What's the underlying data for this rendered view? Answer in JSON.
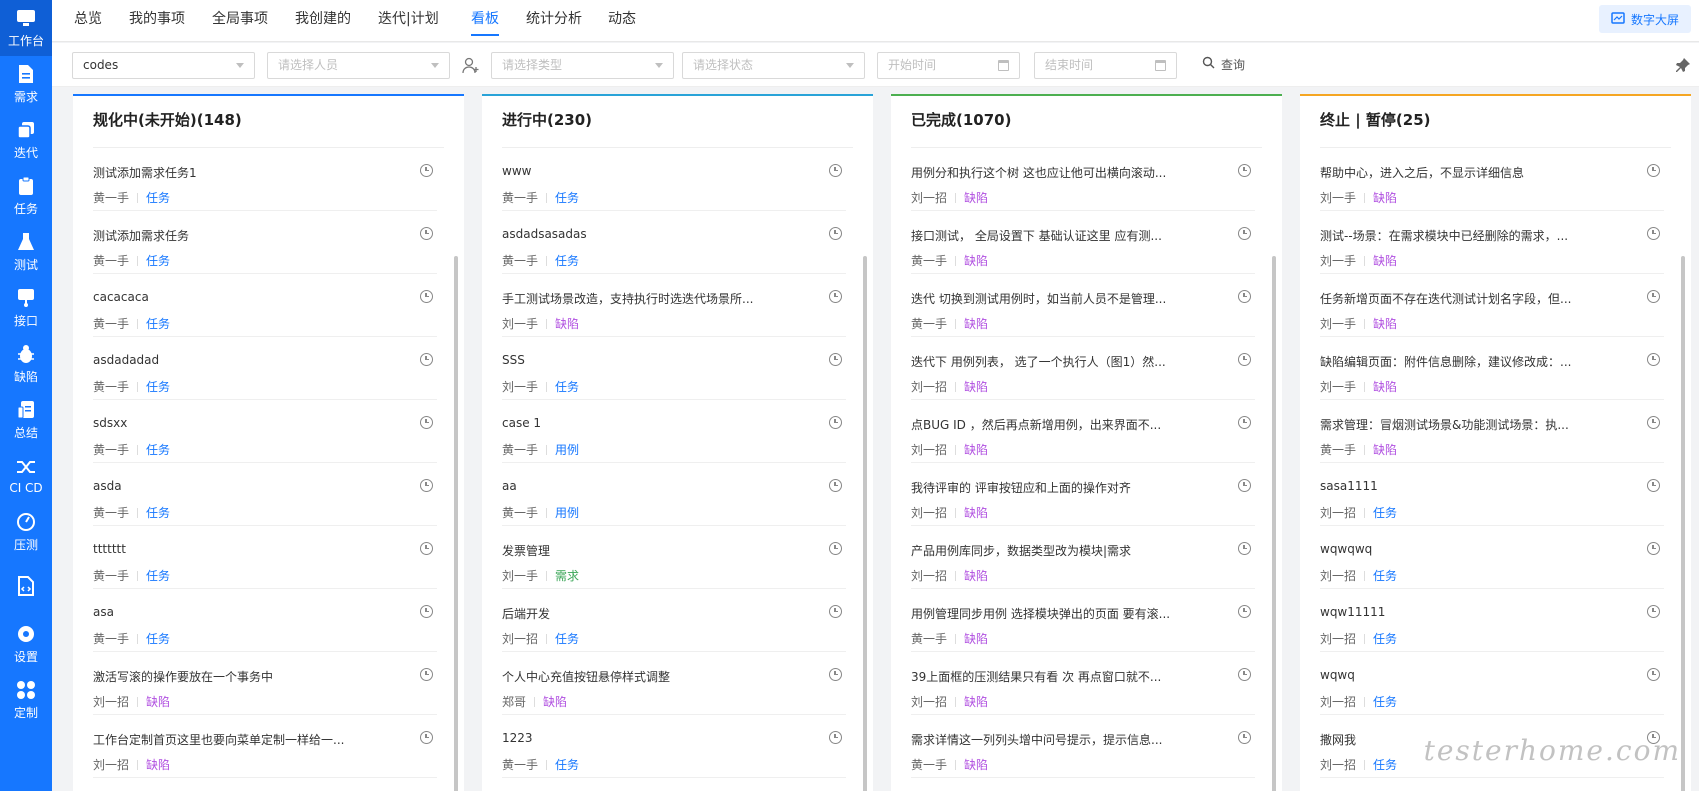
{
  "sidebar": {
    "items": [
      {
        "label": "工作台",
        "icon": "monitor-icon"
      },
      {
        "label": "需求",
        "icon": "document-icon"
      },
      {
        "label": "迭代",
        "icon": "layers-icon"
      },
      {
        "label": "任务",
        "icon": "clipboard-icon"
      },
      {
        "label": "测试",
        "icon": "flask-icon"
      },
      {
        "label": "接口",
        "icon": "api-icon"
      },
      {
        "label": "缺陷",
        "icon": "bug-icon"
      },
      {
        "label": "总结",
        "icon": "report-icon"
      },
      {
        "label": "CI CD",
        "icon": "shuffle-icon"
      },
      {
        "label": "压测",
        "icon": "gauge-icon"
      },
      {
        "label": "",
        "icon": "file-code-icon"
      },
      {
        "label": "设置",
        "icon": "gear-icon"
      },
      {
        "label": "定制",
        "icon": "grid-icon"
      }
    ]
  },
  "topnav": {
    "tabs": [
      "总览",
      "我的事项",
      "全局事项",
      "我创建的",
      "迭代|计划",
      "看板",
      "统计分析",
      "动态"
    ],
    "active": "看板",
    "screen_button": "数字大屏"
  },
  "filters": {
    "project": "codes",
    "person_placeholder": "请选择人员",
    "type_placeholder": "请选择类型",
    "status_placeholder": "请选择状态",
    "start_placeholder": "开始时间",
    "end_placeholder": "结束时间",
    "query_label": "查询"
  },
  "colors": {
    "planning": "#1677ff",
    "in_progress": "#29a3d8",
    "done": "#4caf50",
    "stopped": "#f5a623"
  },
  "columns": [
    {
      "title": "规化中(未开始)(148)",
      "cards": [
        {
          "title": "测试添加需求任务1",
          "person": "黄一手",
          "type": "任务"
        },
        {
          "title": "测试添加需求任务",
          "person": "黄一手",
          "type": "任务"
        },
        {
          "title": "cacacaca",
          "person": "黄一手",
          "type": "任务"
        },
        {
          "title": "asdadadad",
          "person": "黄一手",
          "type": "任务"
        },
        {
          "title": "sdsxx",
          "person": "黄一手",
          "type": "任务"
        },
        {
          "title": "asda",
          "person": "黄一手",
          "type": "任务"
        },
        {
          "title": "ttttttt",
          "person": "黄一手",
          "type": "任务"
        },
        {
          "title": "asa",
          "person": "黄一手",
          "type": "任务"
        },
        {
          "title": "激活写滚的操作要放在一个事务中",
          "person": "刘一招",
          "type": "缺陷"
        },
        {
          "title": "工作台定制首页这里也要向菜单定制一样给一...",
          "person": "刘一招",
          "type": "缺陷"
        }
      ]
    },
    {
      "title": "进行中(230)",
      "cards": [
        {
          "title": "www",
          "person": "黄一手",
          "type": "任务"
        },
        {
          "title": "asdadsasadas",
          "person": "黄一手",
          "type": "任务"
        },
        {
          "title": "手工测试场景改造，支持执行时选迭代场景所...",
          "person": "刘一手",
          "type": "缺陷"
        },
        {
          "title": "SSS",
          "person": "刘一手",
          "type": "任务"
        },
        {
          "title": "case 1",
          "person": "黄一手",
          "type": "用例"
        },
        {
          "title": "aa",
          "person": "黄一手",
          "type": "用例"
        },
        {
          "title": "发票管理",
          "person": "刘一手",
          "type": "需求"
        },
        {
          "title": "后端开发",
          "person": "刘一招",
          "type": "任务"
        },
        {
          "title": "个人中心充值按钮悬停样式调整",
          "person": "郑哥",
          "type": "缺陷"
        },
        {
          "title": "1223",
          "person": "黄一手",
          "type": "任务"
        }
      ]
    },
    {
      "title": "已完成(1070)",
      "cards": [
        {
          "title": "用例分和执行这个树 这也应让他可出横向滚动...",
          "person": "刘一招",
          "type": "缺陷"
        },
        {
          "title": "接口测试， 全局设置下 基础认证这里 应有测...",
          "person": "黄一手",
          "type": "缺陷"
        },
        {
          "title": "迭代 切换到测试用例时，如当前人员不是管理...",
          "person": "黄一手",
          "type": "缺陷"
        },
        {
          "title": "迭代下 用例列表， 选了一个执行人（图1）然...",
          "person": "刘一招",
          "type": "缺陷"
        },
        {
          "title": "点BUG ID ，然后再点新增用例，出来界面不...",
          "person": "刘一招",
          "type": "缺陷"
        },
        {
          "title": "我待评审的 评审按钮应和上面的操作对齐",
          "person": "刘一招",
          "type": "缺陷"
        },
        {
          "title": "产品用例库同步，数据类型改为模块|需求",
          "person": "刘一招",
          "type": "缺陷"
        },
        {
          "title": "用例管理同步用例 选择模块弹出的页面 要有滚...",
          "person": "黄一手",
          "type": "缺陷"
        },
        {
          "title": "39上面框的压测结果只有看 次 再点窗口就不...",
          "person": "刘一招",
          "type": "缺陷"
        },
        {
          "title": "需求详情这一列列头增中问号提示，提示信息...",
          "person": "黄一手",
          "type": "缺陷"
        }
      ]
    },
    {
      "title": "终止 | 暂停(25)",
      "cards": [
        {
          "title": "帮助中心，进入之后，不显示详细信息",
          "person": "刘一手",
          "type": "缺陷"
        },
        {
          "title": "测试--场景：在需求模块中已经删除的需求，...",
          "person": "刘一手",
          "type": "缺陷"
        },
        {
          "title": "任务新增页面不存在迭代测试计划名字段，但...",
          "person": "刘一手",
          "type": "缺陷"
        },
        {
          "title": "缺陷编辑页面：附件信息删除，建议修改成：...",
          "person": "刘一手",
          "type": "缺陷"
        },
        {
          "title": "需求管理：冒烟测试场景&功能测试场景：执...",
          "person": "黄一手",
          "type": "缺陷"
        },
        {
          "title": "sasa1111",
          "person": "刘一招",
          "type": "任务"
        },
        {
          "title": "wqwqwq",
          "person": "刘一招",
          "type": "任务"
        },
        {
          "title": "wqw11111",
          "person": "刘一招",
          "type": "任务"
        },
        {
          "title": "wqwq",
          "person": "刘一招",
          "type": "任务"
        },
        {
          "title": "撒网我",
          "person": "刘一招",
          "type": "任务"
        }
      ]
    }
  ],
  "watermark": "testerhome.com"
}
